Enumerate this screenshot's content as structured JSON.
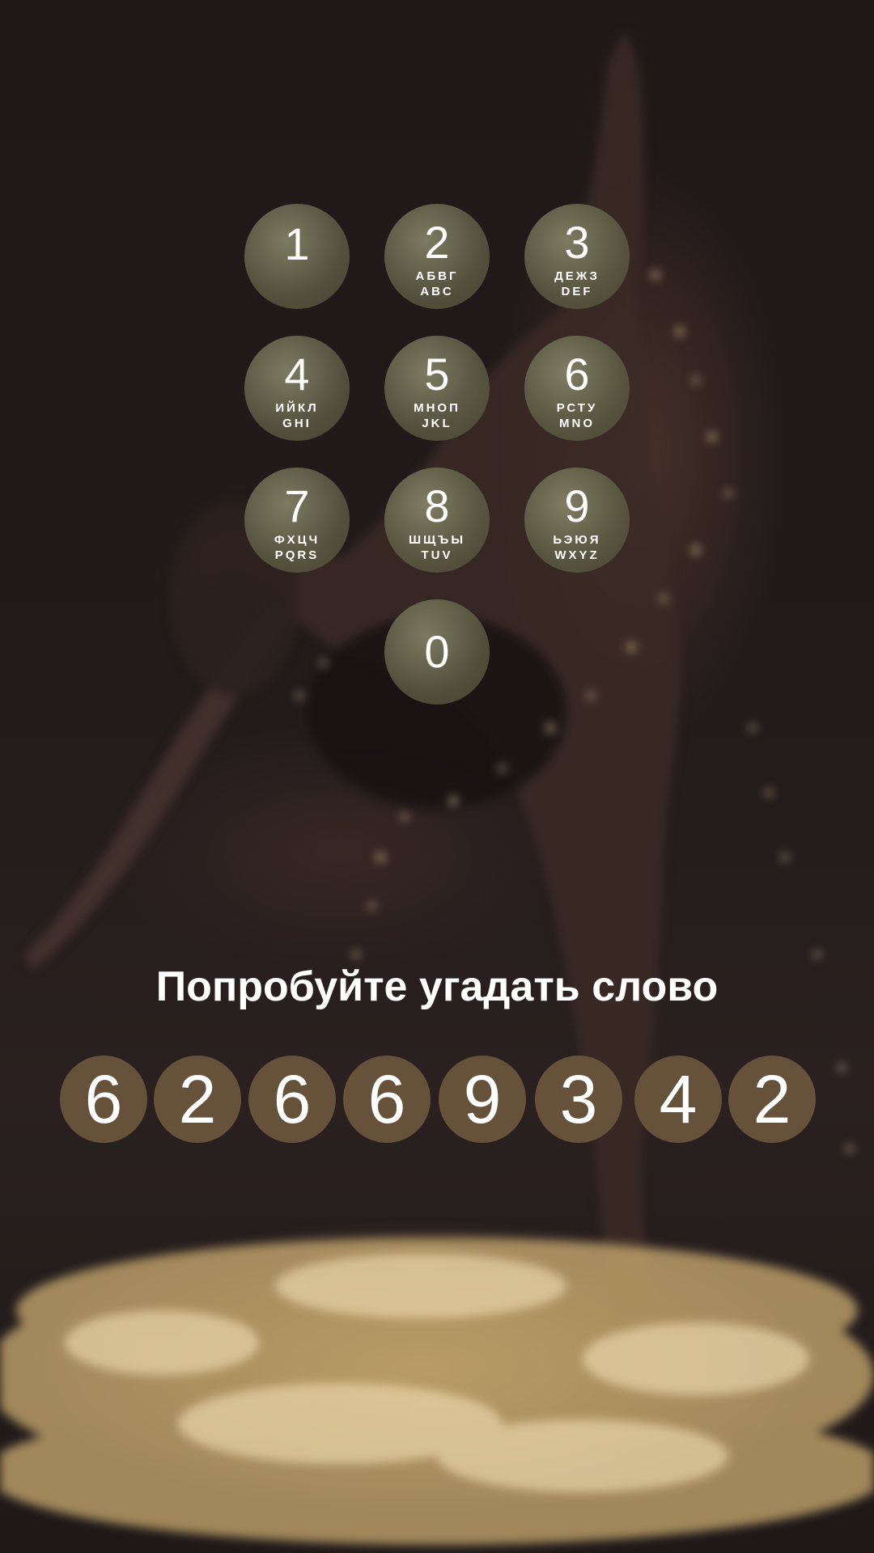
{
  "keypad": {
    "keys": [
      {
        "digit": "1",
        "cyrillic": "",
        "latin": ""
      },
      {
        "digit": "2",
        "cyrillic": "АБВГ",
        "latin": "ABC"
      },
      {
        "digit": "3",
        "cyrillic": "ДЕЖЗ",
        "latin": "DEF"
      },
      {
        "digit": "4",
        "cyrillic": "ИЙКЛ",
        "latin": "GHI"
      },
      {
        "digit": "5",
        "cyrillic": "МНОП",
        "latin": "JKL"
      },
      {
        "digit": "6",
        "cyrillic": "РСТУ",
        "latin": "MNO"
      },
      {
        "digit": "7",
        "cyrillic": "ФХЦЧ",
        "latin": "PQRS"
      },
      {
        "digit": "8",
        "cyrillic": "ШЩЪЫ",
        "latin": "TUV"
      },
      {
        "digit": "9",
        "cyrillic": "ЬЭЮЯ",
        "latin": "WXYZ"
      },
      {
        "digit": "0",
        "cyrillic": "",
        "latin": ""
      }
    ]
  },
  "prompt": "Попробуйте угадать слово",
  "code": [
    "6",
    "2",
    "6",
    "6",
    "9",
    "3",
    "4",
    "2"
  ],
  "colors": {
    "key_fill": "#5f5f46",
    "code_fill": "#66523a",
    "text": "#ffffff"
  }
}
